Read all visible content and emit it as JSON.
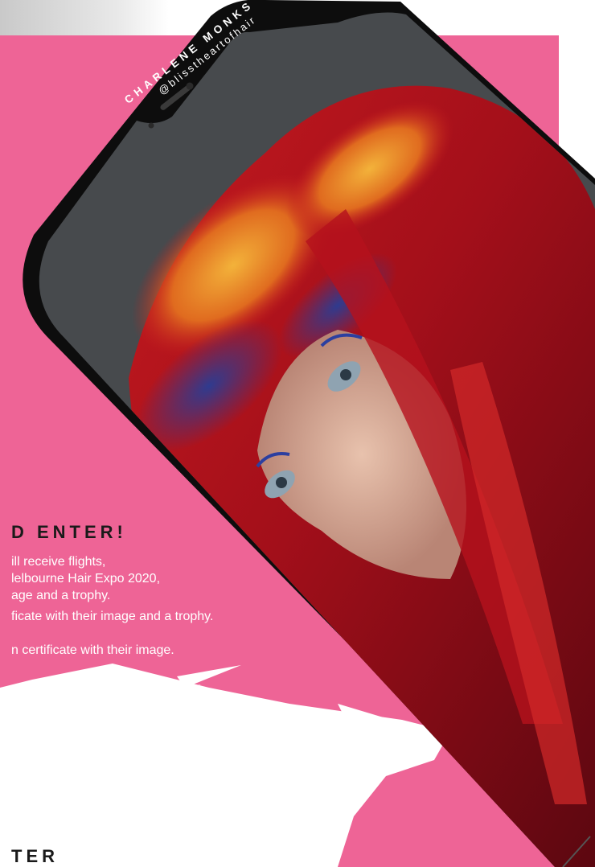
{
  "profile": {
    "name": "CHARLENE MONKS",
    "handle": "@blisstheartofhair"
  },
  "promo": {
    "headline": "D ENTER!",
    "line1a": "ill receive flights,",
    "line1b": "lelbourne Hair Expo 2020,",
    "line1c": "age and a trophy.",
    "line2": "ficate with their image and a trophy.",
    "line3": "n certificate with their image.",
    "headline2": "TER"
  },
  "colors": {
    "panel": "#ee6496",
    "phone_frame": "#0d0d0d",
    "headline": "#1a1a1a",
    "copy": "#ffffff"
  }
}
